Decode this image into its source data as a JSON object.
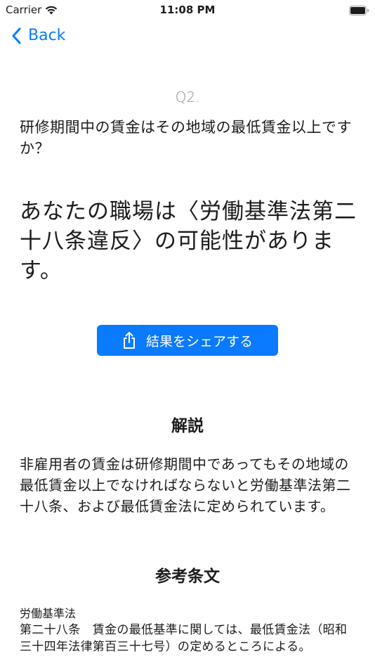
{
  "status_bar": {
    "carrier": "Carrier",
    "time": "11:08 PM",
    "icons": [
      "wifi-icon",
      "battery-icon"
    ]
  },
  "nav": {
    "back_label": "Back",
    "back_icon": "chevron-left-icon"
  },
  "question": {
    "number": "Q2.",
    "text": "研修期間中の賃金はその地域の最低賃金以上ですか？"
  },
  "result": {
    "text": "あなたの職場は〈労働基準法第二十八条違反〉の可能性があります。"
  },
  "share_button": {
    "label": "結果をシェアする",
    "icon": "share-icon"
  },
  "explanation": {
    "title": "解説",
    "text": "非雇用者の賃金は研修期間中であってもその地域の最低賃金以上でなければならないと労働基準法第二十八条、および最低賃金法に定められています。"
  },
  "reference": {
    "title": "参考条文",
    "law_name": "労働基準法",
    "article": "第二十八条　賃金の最低基準に関しては、最低賃金法（昭和三十四年法律第百三十七号）の定めるところによる。"
  },
  "colors": {
    "accent": "#0a7aff",
    "secondary_text": "#8e8e93",
    "text": "#1c1c1e",
    "background": "#ffffff"
  }
}
